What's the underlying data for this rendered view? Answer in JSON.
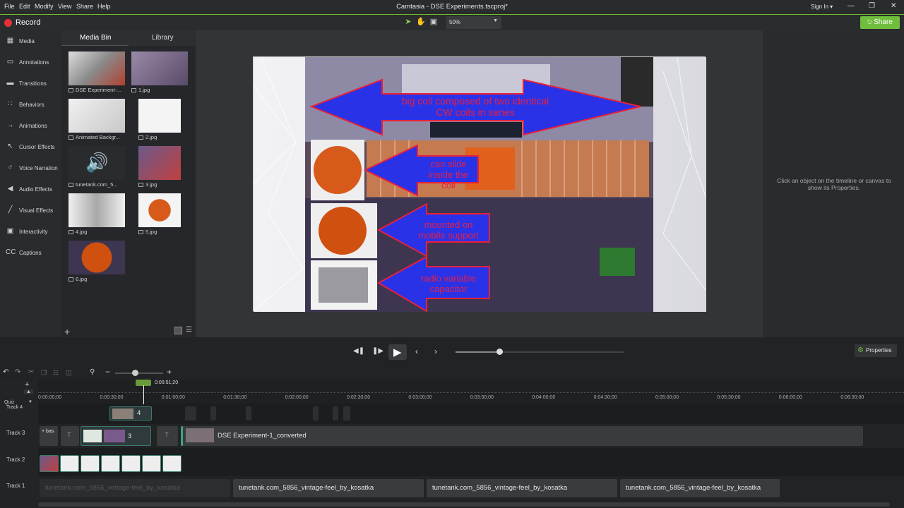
{
  "menu": [
    "File",
    "Edit",
    "Modify",
    "View",
    "Share",
    "Help"
  ],
  "window_title": "Camtasia - DSE Experiments.tscproj*",
  "signin": "Sign In ▾",
  "toolbar": {
    "record_label": "Record",
    "zoom": "50%",
    "share_label": "Share"
  },
  "sidebar": [
    {
      "label": "Media",
      "icon": "film-icon"
    },
    {
      "label": "Annotations",
      "icon": "annotation-icon"
    },
    {
      "label": "Transitions",
      "icon": "transition-icon"
    },
    {
      "label": "Behaviors",
      "icon": "behavior-icon"
    },
    {
      "label": "Animations",
      "icon": "animation-icon"
    },
    {
      "label": "Cursor Effects",
      "icon": "cursor-icon"
    },
    {
      "label": "Voice Narration",
      "icon": "microphone-icon"
    },
    {
      "label": "Audio Effects",
      "icon": "speaker-icon"
    },
    {
      "label": "Visual Effects",
      "icon": "wand-icon"
    },
    {
      "label": "Interactivity",
      "icon": "interactivity-icon"
    },
    {
      "label": "Captions",
      "icon": "captions-icon"
    }
  ],
  "bin": {
    "tabs": [
      "Media Bin",
      "Library"
    ],
    "items": [
      {
        "label": "DSE Experiment-..."
      },
      {
        "label": "1.jpg"
      },
      {
        "label": "Animated Backgr..."
      },
      {
        "label": "2.jpg"
      },
      {
        "label": "tunetank.com_5..."
      },
      {
        "label": "3.jpg"
      },
      {
        "label": "4.jpg"
      },
      {
        "label": "5.jpg"
      },
      {
        "label": "6.jpg"
      }
    ]
  },
  "canvas": {
    "arrows": [
      "big coil composed of two identical CW coils in series",
      "can slide inside the coil",
      "mounted on mobile support",
      "radio variable capacitor"
    ]
  },
  "properties_hint": "Click an object on the timeline or canvas to show its Properties.",
  "player": {
    "properties_label": "Properties",
    "scrub_position": 0.26
  },
  "timeline": {
    "playhead": "0:00:51;20",
    "ticks": [
      "0:00:00;00",
      "0:00:30;00",
      "0:01:00;00",
      "0:01:30;00",
      "0:02:00;00",
      "0:02:30;00",
      "0:03:00;00",
      "0:03:30;00",
      "0:04:00;00",
      "0:04:30;00",
      "0:05:00;00",
      "0:05:30;00",
      "0:06:00;00",
      "0:06:30;00"
    ],
    "quiz_label": "Quiz",
    "tracks": [
      "Track 4",
      "Track 3",
      "Track 2",
      "Track 1"
    ],
    "track4_group": "4",
    "track3_group": "3",
    "track3_bas": "+ bas",
    "track3_main_clip": "DSE Experiment-1_converted",
    "audio_clips": [
      "tunetank.com_5856_vintage-feel_by_kosatka",
      "tunetank.com_5856_vintage-feel_by_kosatka",
      "tunetank.com_5856_vintage-feel_by_kosatka",
      "tunetank.com_5856_vintage-feel_by_kosatka"
    ]
  },
  "colors": {
    "accent": "#6fbe3c",
    "record": "#e8303a",
    "arrow_fill": "#2a32e8",
    "arrow_stroke": "#e8203a",
    "arrow_text": "#e82040"
  }
}
